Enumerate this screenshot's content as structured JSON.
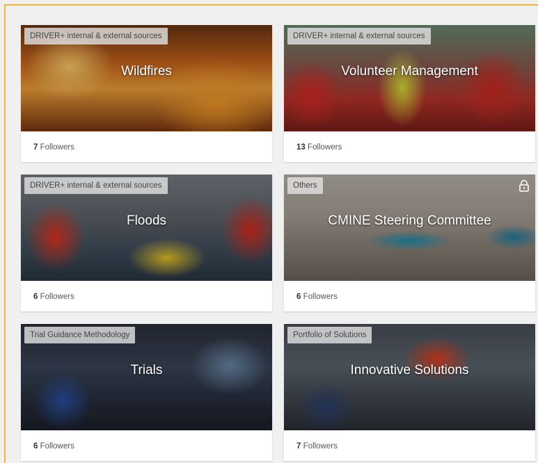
{
  "cards": [
    {
      "tag": "DRIVER+ internal & external sources",
      "title": "Wildfires",
      "followers_count": "7",
      "followers_label": "Followers",
      "image": "wildfire-firefighter-photo"
    },
    {
      "tag": "DRIVER+ internal & external sources",
      "title": "Volunteer Management",
      "followers_count": "13",
      "followers_label": "Followers",
      "image": "volunteers-red-uniforms-photo"
    },
    {
      "tag": "DRIVER+ internal & external sources",
      "title": "Floods",
      "followers_count": "6",
      "followers_label": "Followers",
      "image": "flood-rescue-photo"
    },
    {
      "tag": "Others",
      "title": "CMINE Steering Committee",
      "followers_count": "6",
      "followers_label": "Followers",
      "image": "panel-meeting-photo",
      "locked": true,
      "lock_icon": "lock-icon"
    },
    {
      "tag": "Trial Guidance Methodology",
      "title": "Trials",
      "followers_count": "6",
      "followers_label": "Followers",
      "image": "control-room-photo"
    },
    {
      "tag": "Portfolio of Solutions",
      "title": "Innovative Solutions",
      "followers_count": "7",
      "followers_label": "Followers",
      "image": "monitoring-screens-photo"
    }
  ],
  "colors": {
    "frame_accent": "#f0b43c",
    "card_bg": "#ffffff",
    "page_bg": "#f0f0f0"
  }
}
